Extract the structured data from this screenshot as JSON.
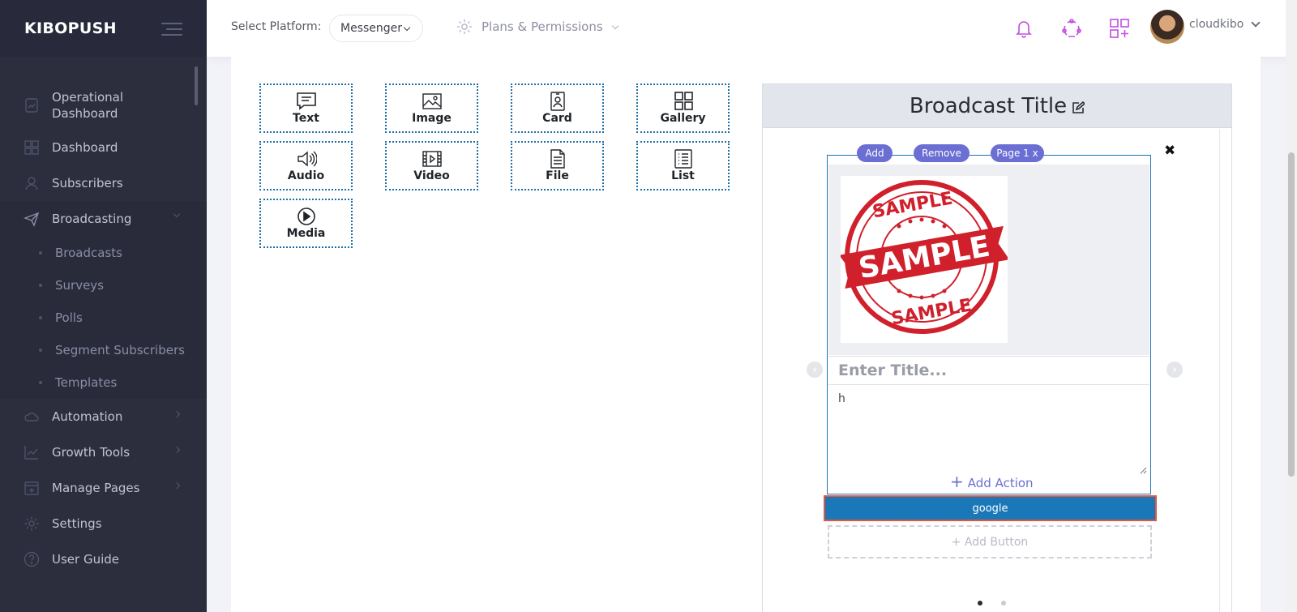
{
  "sidebar": {
    "brand": "KIBOPUSH",
    "items": [
      {
        "label": "Operational Dashboard",
        "icon": "operational-dashboard-icon"
      },
      {
        "label": "Dashboard",
        "icon": "dashboard-grid-icon"
      },
      {
        "label": "Subscribers",
        "icon": "user-icon"
      },
      {
        "label": "Broadcasting",
        "icon": "paper-plane-icon",
        "expanded": true
      },
      {
        "label": "Automation",
        "icon": "cloud-icon"
      },
      {
        "label": "Growth Tools",
        "icon": "chart-line-icon"
      },
      {
        "label": "Manage Pages",
        "icon": "calendar-plus-icon"
      },
      {
        "label": "Settings",
        "icon": "gear-icon"
      },
      {
        "label": "User Guide",
        "icon": "question-circle-icon"
      }
    ],
    "broadcasting_sub": [
      "Broadcasts",
      "Surveys",
      "Polls",
      "Segment Subscribers",
      "Templates"
    ]
  },
  "header": {
    "platform_label": "Select Platform:",
    "platform_value": "Messenger",
    "plans": "Plans & Permissions",
    "username": "cloudkibo",
    "accent": "#c34ee0"
  },
  "components": [
    {
      "label": "Text",
      "icon": "text-message-icon"
    },
    {
      "label": "Image",
      "icon": "image-icon"
    },
    {
      "label": "Card",
      "icon": "card-icon"
    },
    {
      "label": "Gallery",
      "icon": "gallery-icon"
    },
    {
      "label": "Audio",
      "icon": "audio-icon"
    },
    {
      "label": "Video",
      "icon": "video-icon"
    },
    {
      "label": "File",
      "icon": "file-icon"
    },
    {
      "label": "List",
      "icon": "list-icon"
    },
    {
      "label": "Media",
      "icon": "play-icon"
    }
  ],
  "preview": {
    "title": "Broadcast Title",
    "pills": [
      "Add",
      "Remove",
      "Page 1 x"
    ],
    "close": "✖",
    "stamp_top": "SAMPLE",
    "stamp_mid": "SAMPLE",
    "stamp_bottom": "SAMPLE",
    "title_placeholder": "Enter Title...",
    "subtitle_value": "h",
    "add_action": "Add Action",
    "button_label": "google",
    "add_button": "+ Add Button",
    "active_page": 1,
    "page_count": 2
  }
}
